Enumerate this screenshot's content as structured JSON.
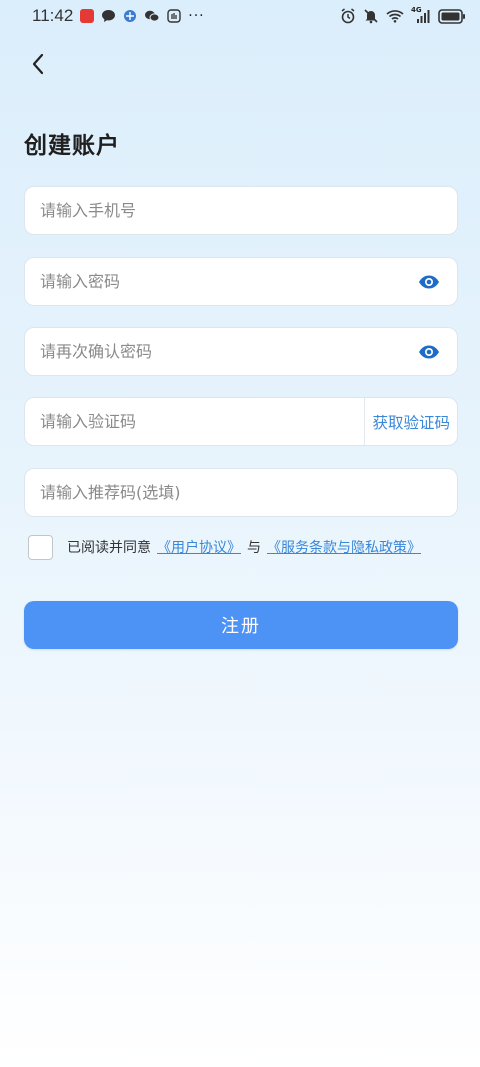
{
  "status_bar": {
    "time": "11:42",
    "notif_colors": [
      "#e53935",
      "#3a7bd5",
      "#3a7bd5"
    ],
    "more": "···",
    "network": "4G"
  },
  "page": {
    "title": "创建账户"
  },
  "form": {
    "phone_placeholder": "请输入手机号",
    "password_placeholder": "请输入密码",
    "confirm_placeholder": "请再次确认密码",
    "code_placeholder": "请输入验证码",
    "get_code_label": "获取验证码",
    "referral_placeholder": "请输入推荐码(选填)"
  },
  "agreement": {
    "prefix": "已阅读并同意",
    "user_agreement": "《用户协议》",
    "connector": "与",
    "privacy_policy": "《服务条款与隐私政策》",
    "checked": false
  },
  "submit": {
    "label": "注册"
  },
  "colors": {
    "accent": "#4d92f5",
    "link": "#3a87d8"
  }
}
